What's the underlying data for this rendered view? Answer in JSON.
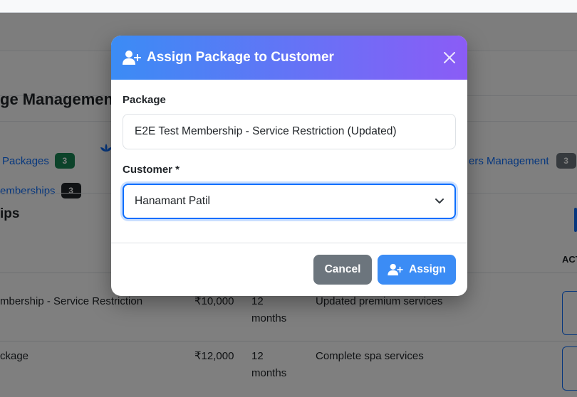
{
  "background": {
    "page_title": "ge Managemen",
    "tabs": [
      {
        "label": "Packages",
        "count": "3"
      },
      {
        "label": "ers Management",
        "count": "3"
      },
      {
        "label": "emberships",
        "count": "3"
      }
    ],
    "section_title": "ips",
    "table": {
      "actions_header": "ACT",
      "rows": [
        {
          "name": "mbership - Service Restriction",
          "price": "₹10,000",
          "duration_num": "12",
          "duration_unit": "months",
          "description": "Updated premium services"
        },
        {
          "name": "ckage",
          "price": "₹12,000",
          "duration_num": "12",
          "duration_unit": "months",
          "description": "Complete spa services"
        }
      ]
    }
  },
  "modal": {
    "title": "Assign Package to Customer",
    "header_icon": "user-plus-icon",
    "close_icon": "close-icon",
    "package_label": "Package",
    "package_value": "E2E Test Membership - Service Restriction (Updated)",
    "customer_label": "Customer *",
    "customer_selected": "Hanamant Patil",
    "cancel_label": "Cancel",
    "assign_label": "Assign",
    "assign_icon": "user-plus-icon"
  },
  "colors": {
    "header_gradient_start": "#3b8cf5",
    "header_gradient_end": "#8b5cf6",
    "primary": "#0d6efd",
    "cancel": "#6c757d"
  }
}
